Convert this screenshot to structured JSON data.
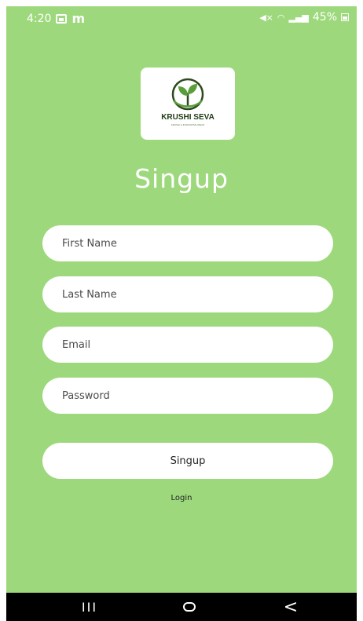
{
  "status_bar": {
    "time": "4:20",
    "battery": "45%",
    "icons": [
      "gallery-icon",
      "m-icon",
      "mute-icon",
      "wifi-icon",
      "signal-icon",
      "battery-icon"
    ]
  },
  "logo": {
    "title": "KRUSHI SEVA",
    "tagline": "KRUSHI & INNOVATIVE IDEAS",
    "icon": "sprout-icon"
  },
  "page": {
    "title": "Singup"
  },
  "form": {
    "first_name_placeholder": "First Name",
    "last_name_placeholder": "Last Name",
    "email_placeholder": "Email",
    "password_placeholder": "Password",
    "submit_label": "Singup",
    "login_link": "Login"
  },
  "nav_bar": {
    "recents_glyph": "III",
    "back_glyph": "<"
  },
  "colors": {
    "background": "#9dd97c",
    "field": "#ffffff",
    "title": "#ffffff",
    "nav_bar": "#000000"
  }
}
